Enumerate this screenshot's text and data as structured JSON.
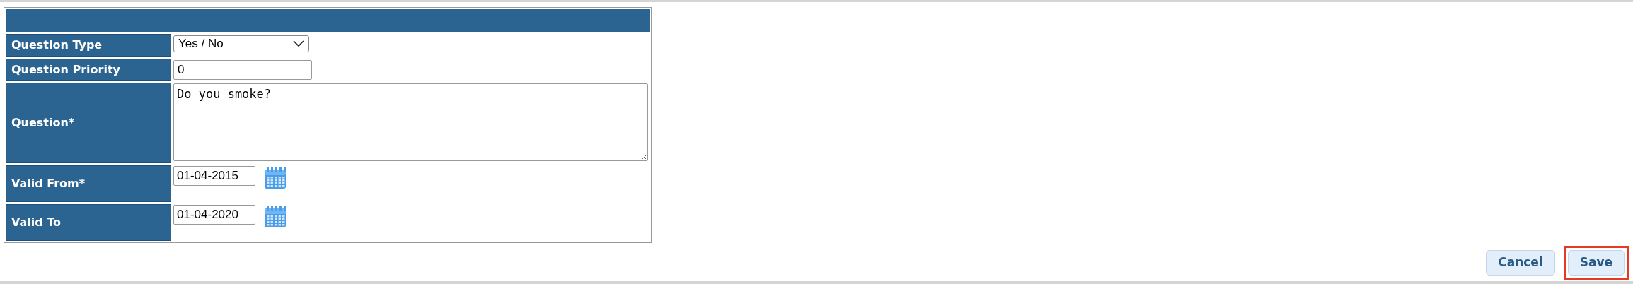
{
  "form": {
    "rows": [
      {
        "kind": "select",
        "label": "Question Type",
        "value": "Yes / No"
      },
      {
        "kind": "input",
        "label": "Question Priority",
        "value": "0"
      },
      {
        "kind": "textarea",
        "label": "Question*",
        "value": "Do you smoke?"
      },
      {
        "kind": "date",
        "label": "Valid From*",
        "value": "01-04-2015"
      },
      {
        "kind": "date",
        "label": "Valid To",
        "value": "01-04-2020"
      }
    ]
  },
  "buttons": [
    {
      "label": "Cancel",
      "highlighted": false
    },
    {
      "label": "Save",
      "highlighted": true
    }
  ]
}
